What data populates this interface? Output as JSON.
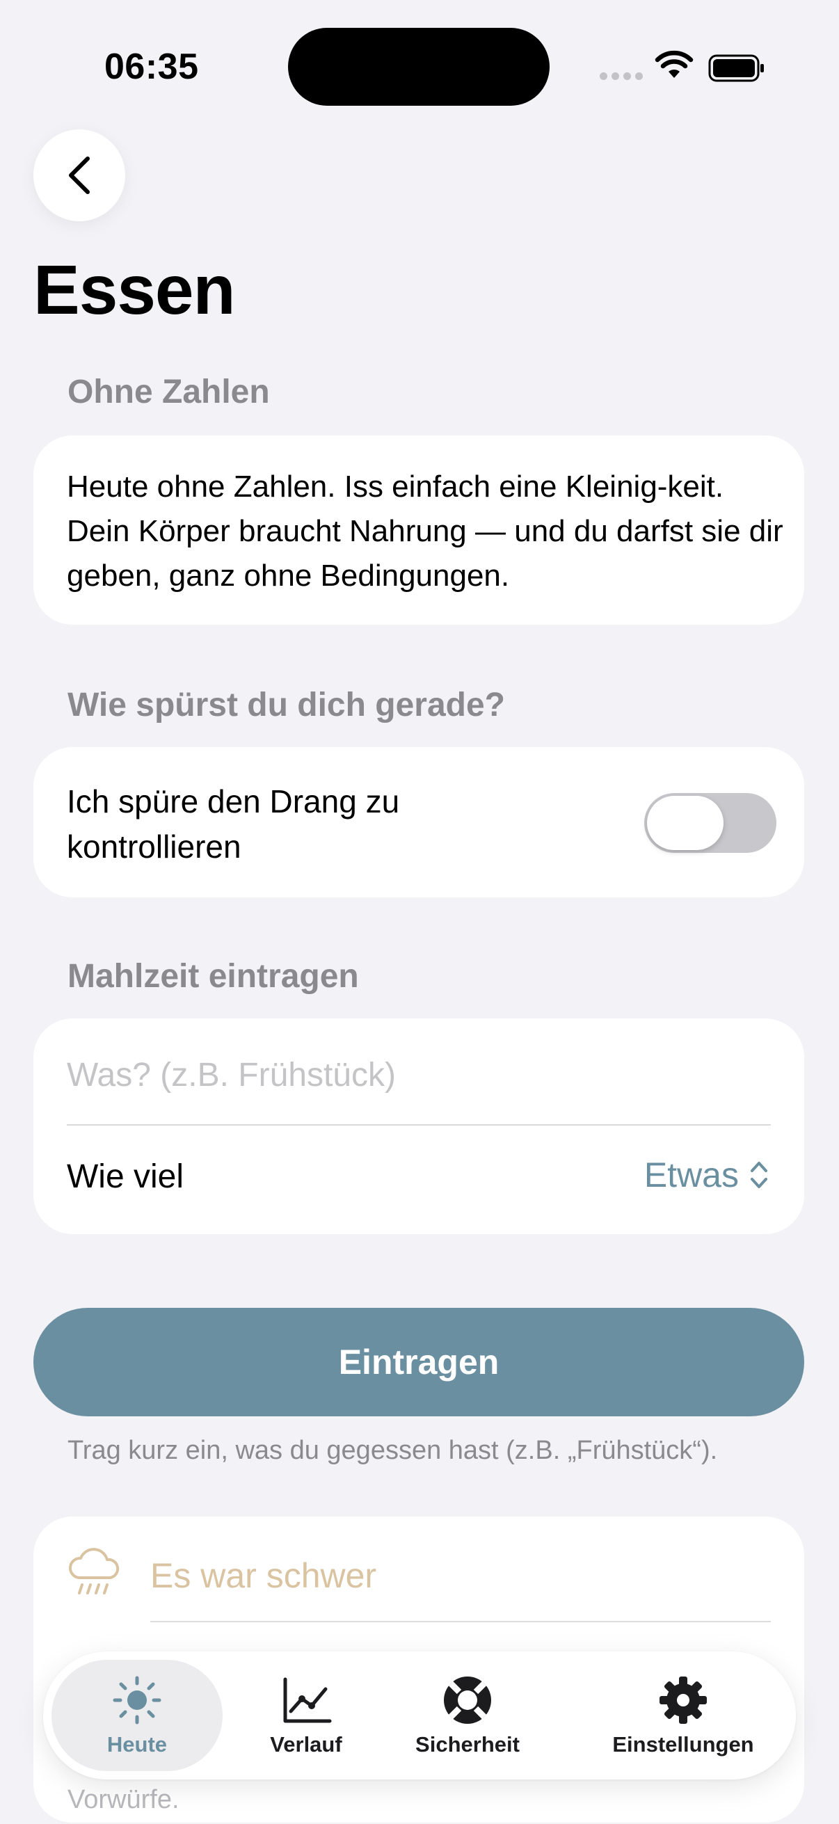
{
  "status_bar": {
    "time": "06:35"
  },
  "header": {
    "title": "Essen"
  },
  "sections": {
    "info": {
      "label": "Ohne Zahlen",
      "text": "Heute ohne Zahlen. Iss einfach eine Kleinig-keit. Dein Körper braucht Nahrung — und du darfst sie dir geben, ganz ohne Bedingungen."
    },
    "feeling": {
      "label": "Wie spürst du dich gerade?",
      "toggle_label": "Ich spüre den Drang zu kontrollieren",
      "toggle_on": false
    },
    "meal": {
      "label": "Mahlzeit eintragen",
      "input_placeholder": "Was? (z.B. Frühstück)",
      "input_value": "",
      "amount_label": "Wie viel",
      "amount_value": "Etwas"
    }
  },
  "submit": {
    "label": "Eintragen",
    "hint": "Trag kurz ein, was du gegessen hast (z.B. „Frühstück“)."
  },
  "mood_card": {
    "first_item": "Es war schwer",
    "icon": "cloud-rain-icon"
  },
  "peek_text": "Vorwürfe.",
  "tab_bar": {
    "tabs": [
      {
        "label": "Heute",
        "icon": "sun-icon",
        "active": true
      },
      {
        "label": "Verlauf",
        "icon": "chart-line-icon",
        "active": false
      },
      {
        "label": "Sicherheit",
        "icon": "lifebuoy-icon",
        "active": false
      },
      {
        "label": "Einstellungen",
        "icon": "gear-icon",
        "active": false
      }
    ]
  },
  "colors": {
    "background": "#f2f2f7",
    "accent": "#6a8fa0",
    "mood_label": "#d9c3a0",
    "section_label": "#8a8a8e"
  }
}
